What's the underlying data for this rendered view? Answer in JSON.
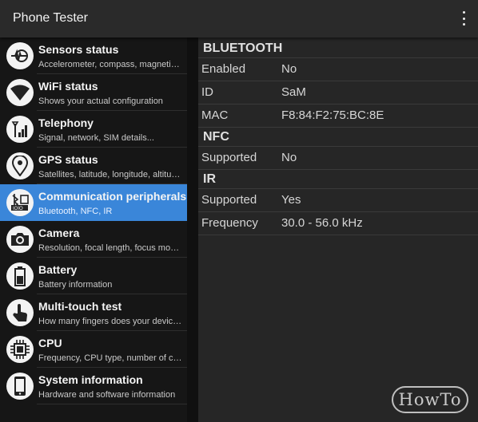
{
  "app": {
    "title": "Phone Tester",
    "menu_icon": "more-vert-icon"
  },
  "sidebar": {
    "items": [
      {
        "title": "Sensors status",
        "subtitle": "Accelerometer, compass, magnetic field...",
        "icon": "sensor-pulse-icon",
        "selected": false
      },
      {
        "title": "WiFi status",
        "subtitle": "Shows your actual configuration",
        "icon": "wifi-icon",
        "selected": false
      },
      {
        "title": "Telephony",
        "subtitle": "Signal, network, SIM details...",
        "icon": "signal-bars-icon",
        "selected": false
      },
      {
        "title": "GPS status",
        "subtitle": "Satellites, latitude, longitude, altitude...",
        "icon": "location-pin-icon",
        "selected": false
      },
      {
        "title": "Communication peripherals",
        "subtitle": "Bluetooth, NFC, IR",
        "icon": "bluetooth-nfc-icon",
        "selected": true
      },
      {
        "title": "Camera",
        "subtitle": "Resolution, focal length, focus mode...",
        "icon": "camera-icon",
        "selected": false
      },
      {
        "title": "Battery",
        "subtitle": "Battery information",
        "icon": "battery-icon",
        "selected": false
      },
      {
        "title": "Multi-touch test",
        "subtitle": "How many fingers does your device recognize",
        "icon": "touch-hand-icon",
        "selected": false
      },
      {
        "title": "CPU",
        "subtitle": "Frequency, CPU type, number of cores...",
        "icon": "cpu-chip-icon",
        "selected": false
      },
      {
        "title": "System information",
        "subtitle": "Hardware and software information",
        "icon": "phone-device-icon",
        "selected": false
      }
    ]
  },
  "detail": {
    "bluetooth": {
      "header": "BLUETOOTH",
      "rows": [
        {
          "key": "Enabled",
          "value": "No"
        },
        {
          "key": "ID",
          "value": "SaM"
        },
        {
          "key": "MAC",
          "value": "F8:84:F2:75:BC:8E"
        }
      ]
    },
    "nfc": {
      "header": "NFC",
      "rows": [
        {
          "key": "Supported",
          "value": "No"
        }
      ]
    },
    "ir": {
      "header": "IR",
      "rows": [
        {
          "key": "Supported",
          "value": "Yes"
        },
        {
          "key": "Frequency",
          "value": "30.0 - 56.0 kHz"
        }
      ]
    }
  },
  "watermark": {
    "text": "HowTo"
  },
  "colors": {
    "accent": "#3a86d9",
    "appbar": "#2a2a2a",
    "panel": "#262626",
    "sidebar": "#161616"
  }
}
